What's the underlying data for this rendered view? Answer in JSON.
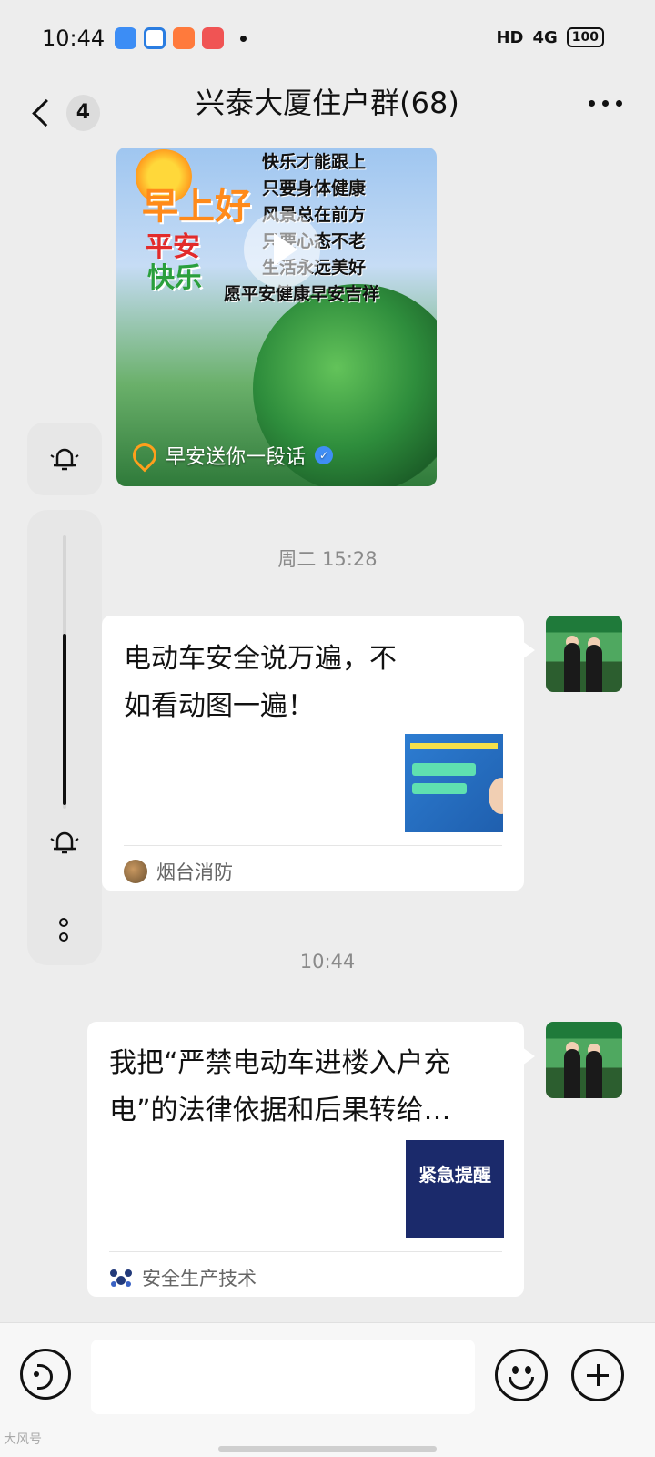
{
  "status": {
    "time": "10:44",
    "network": "HD",
    "signal": "4G",
    "battery": "100"
  },
  "header": {
    "title": "兴泰大厦住户群(68)",
    "unread_count": "4"
  },
  "messages": [
    {
      "type": "video",
      "overlay_title1": "早上好",
      "overlay_title2": "平安",
      "overlay_title3": "快乐",
      "overlay_lines": [
        "快乐才能跟上",
        "只要身体健康",
        "风景总在前方",
        "只要心态不老",
        "生活永远美好",
        "愿平安健康早安吉祥"
      ],
      "caption": "早安送你一段话"
    },
    {
      "type": "timestamp",
      "text": "周二 15:28"
    },
    {
      "type": "link",
      "title": "电动车安全说万遍，不如看动图一遍！",
      "source": "烟台消防"
    },
    {
      "type": "timestamp",
      "text": "10:44"
    },
    {
      "type": "link",
      "title": "我把“严禁电动车进楼入户充电”的法律依据和后果转给…",
      "thumb_text": "紧急提醒",
      "source": "安全生产技术"
    }
  ],
  "watermark": "大风号"
}
